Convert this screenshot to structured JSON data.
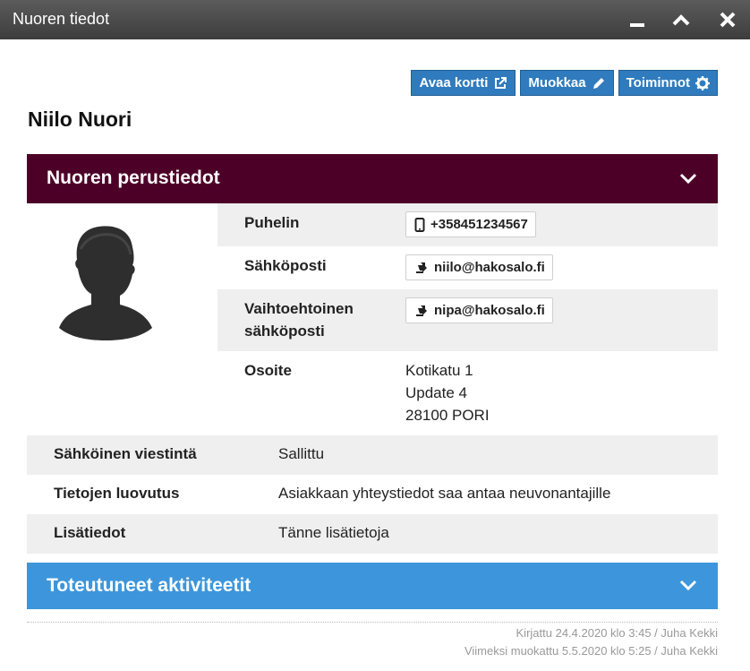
{
  "window": {
    "title": "Nuoren tiedot",
    "controls": [
      "minimize-icon",
      "collapse-up-icon",
      "close-icon"
    ]
  },
  "actions": {
    "open_card": {
      "label": "Avaa kortti",
      "icon": "external-link-icon"
    },
    "edit": {
      "label": "Muokkaa",
      "icon": "pencil-icon"
    },
    "functions": {
      "label": "Toiminnot",
      "icon": "gear-icon"
    }
  },
  "person": {
    "name": "Niilo Nuori"
  },
  "basic_info": {
    "title": "Nuoren perustiedot",
    "color": "#4d0027",
    "phone": {
      "label": "Puhelin",
      "value": "+358451234567",
      "icon": "mobile-phone-icon"
    },
    "email": {
      "label": "Sähköposti",
      "value": "niilo@hakosalo.fi",
      "icon": "mail-send-icon"
    },
    "alt_email": {
      "label_line1": "Vaihtoehtoinen",
      "label_line2": "sähköposti",
      "value": "nipa@hakosalo.fi",
      "icon": "mail-send-icon"
    },
    "address": {
      "label": "Osoite",
      "line1": "Kotikatu 1",
      "line2": "Update 4",
      "line3": "28100 PORI"
    },
    "electronic_comm": {
      "label": "Sähköinen viestintä",
      "value": "Sallittu"
    },
    "data_disclosure": {
      "label": "Tietojen luovutus",
      "value": "Asiakkaan yhteystiedot saa antaa neuvonantajille"
    },
    "additional": {
      "label": "Lisätiedot",
      "value": "Tänne lisätietoja"
    }
  },
  "activities": {
    "title": "Toteutuneet aktiviteetit",
    "color": "#3d96db"
  },
  "footer": {
    "created": "Kirjattu 24.4.2020 klo 3:45 / Juha Kekki",
    "modified": "Viimeksi muokattu 5.5.2020 klo 5:25 / Juha Kekki"
  },
  "colors": {
    "button": "#2f7bbd",
    "titlebar": "#4a4a4a"
  }
}
